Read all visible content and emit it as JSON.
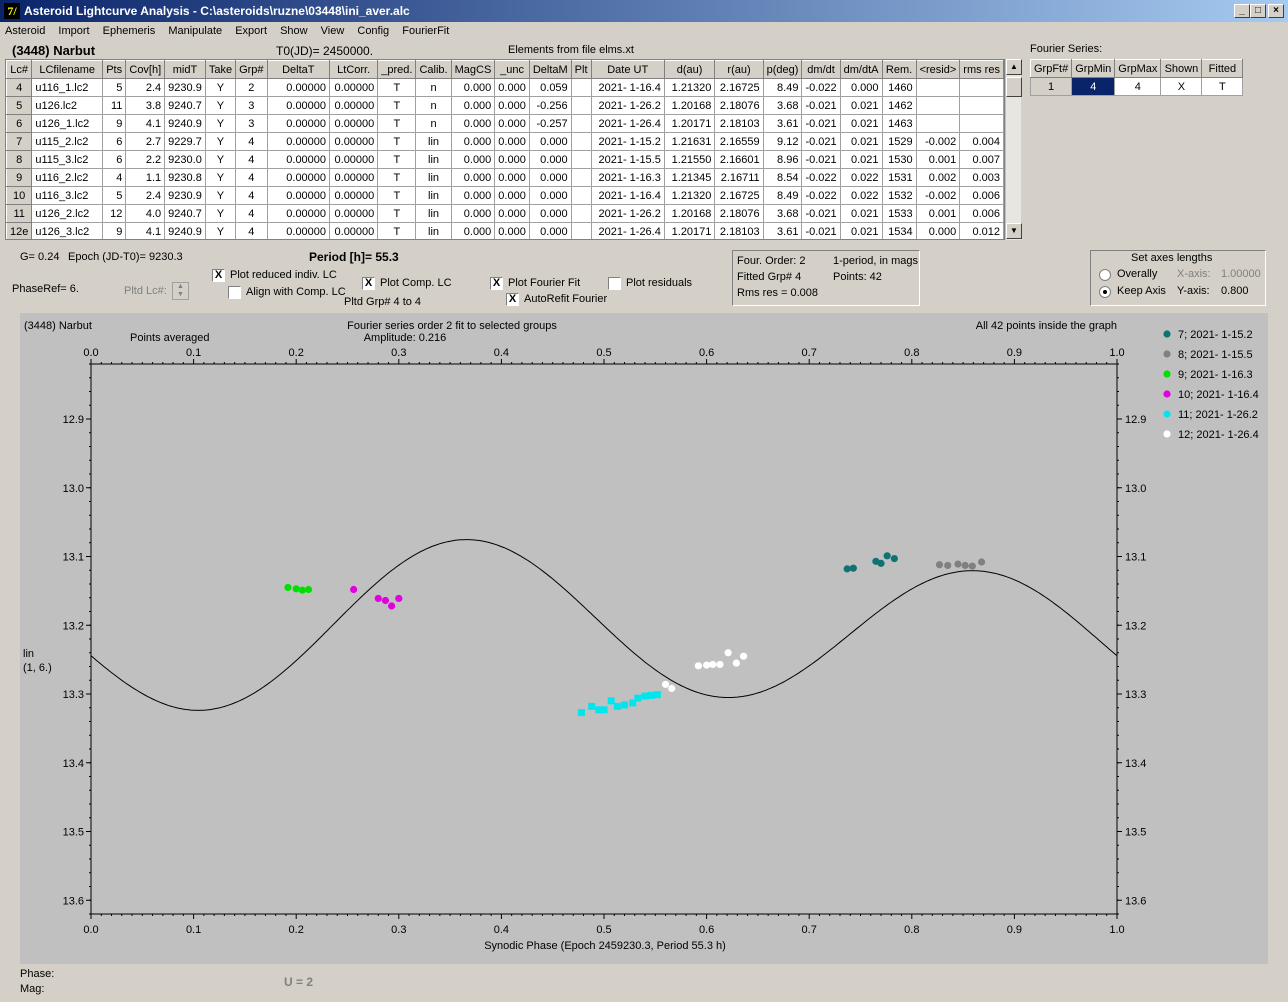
{
  "window": {
    "title": "Asteroid Lightcurve Analysis - C:\\asteroids\\ruzne\\03448\\ini_aver.alc",
    "icon_glyph": "7/"
  },
  "menu": [
    "Asteroid",
    "Import",
    "Ephemeris",
    "Manipulate",
    "Export",
    "Show",
    "View",
    "Config",
    "FourierFit"
  ],
  "header": {
    "asteroid": "(3448) Narbut",
    "t0": "T0(JD)= 2450000.",
    "elements": "Elements from file elms.xt"
  },
  "table": {
    "columns": [
      "Lc#",
      "LCfilename",
      "Pts",
      "Cov[h]",
      "midT",
      "Take",
      "Grp#",
      "DeltaT",
      "LtCorr.",
      "_pred.",
      "Calib.",
      "MagCS",
      "_unc",
      "DeltaM",
      "Plt",
      "Date UT",
      "d(au)",
      "r(au)",
      "p(deg)",
      "dm/dt",
      "dm/dtA",
      "Rem.",
      "<resid>",
      "rms res"
    ],
    "rows": [
      [
        "4",
        "u116_1.lc2",
        "5",
        "2.4",
        "9230.9",
        "Y",
        "2",
        "0.00000",
        "0.00000",
        "T",
        "n",
        "0.000",
        "0.000",
        "0.059",
        "",
        "2021- 1-16.4",
        "1.21320",
        "2.16725",
        "8.49",
        "-0.022",
        "0.000",
        "1460",
        "",
        ""
      ],
      [
        "5",
        "u126.lc2",
        "11",
        "3.8",
        "9240.7",
        "Y",
        "3",
        "0.00000",
        "0.00000",
        "T",
        "n",
        "0.000",
        "0.000",
        "-0.256",
        "",
        "2021- 1-26.2",
        "1.20168",
        "2.18076",
        "3.68",
        "-0.021",
        "0.021",
        "1462",
        "",
        ""
      ],
      [
        "6",
        "u126_1.lc2",
        "9",
        "4.1",
        "9240.9",
        "Y",
        "3",
        "0.00000",
        "0.00000",
        "T",
        "n",
        "0.000",
        "0.000",
        "-0.257",
        "",
        "2021- 1-26.4",
        "1.20171",
        "2.18103",
        "3.61",
        "-0.021",
        "0.021",
        "1463",
        "",
        ""
      ],
      [
        "7",
        "u115_2.lc2",
        "6",
        "2.7",
        "9229.7",
        "Y",
        "4",
        "0.00000",
        "0.00000",
        "T",
        "lin",
        "0.000",
        "0.000",
        "0.000",
        "",
        "2021- 1-15.2",
        "1.21631",
        "2.16559",
        "9.12",
        "-0.021",
        "0.021",
        "1529",
        "-0.002",
        "0.004"
      ],
      [
        "8",
        "u115_3.lc2",
        "6",
        "2.2",
        "9230.0",
        "Y",
        "4",
        "0.00000",
        "0.00000",
        "T",
        "lin",
        "0.000",
        "0.000",
        "0.000",
        "",
        "2021- 1-15.5",
        "1.21550",
        "2.16601",
        "8.96",
        "-0.021",
        "0.021",
        "1530",
        "0.001",
        "0.007"
      ],
      [
        "9",
        "u116_2.lc2",
        "4",
        "1.1",
        "9230.8",
        "Y",
        "4",
        "0.00000",
        "0.00000",
        "T",
        "lin",
        "0.000",
        "0.000",
        "0.000",
        "",
        "2021- 1-16.3",
        "1.21345",
        "2.16711",
        "8.54",
        "-0.022",
        "0.022",
        "1531",
        "0.002",
        "0.003"
      ],
      [
        "10",
        "u116_3.lc2",
        "5",
        "2.4",
        "9230.9",
        "Y",
        "4",
        "0.00000",
        "0.00000",
        "T",
        "lin",
        "0.000",
        "0.000",
        "0.000",
        "",
        "2021- 1-16.4",
        "1.21320",
        "2.16725",
        "8.49",
        "-0.022",
        "0.022",
        "1532",
        "-0.002",
        "0.006"
      ],
      [
        "11",
        "u126_2.lc2",
        "12",
        "4.0",
        "9240.7",
        "Y",
        "4",
        "0.00000",
        "0.00000",
        "T",
        "lin",
        "0.000",
        "0.000",
        "0.000",
        "",
        "2021- 1-26.2",
        "1.20168",
        "2.18076",
        "3.68",
        "-0.021",
        "0.021",
        "1533",
        "0.001",
        "0.006"
      ],
      [
        "12e",
        "u126_3.lc2",
        "9",
        "4.1",
        "9240.9",
        "Y",
        "4",
        "0.00000",
        "0.00000",
        "T",
        "lin",
        "0.000",
        "0.000",
        "0.000",
        "",
        "2021- 1-26.4",
        "1.20171",
        "2.18103",
        "3.61",
        "-0.021",
        "0.021",
        "1534",
        "0.000",
        "0.012"
      ]
    ]
  },
  "fourier": {
    "title": "Fourier Series:",
    "columns": [
      "GrpFt#",
      "GrpMin",
      "GrpMax",
      "Shown",
      "Fitted"
    ],
    "row": [
      "1",
      "4",
      "4",
      "X",
      "T"
    ]
  },
  "info": {
    "g": "G= 0.24",
    "epoch": "Epoch (JD-T0)= 9230.3",
    "period": "Period [h]= 55.3",
    "phaseref": "PhaseRef= 6.",
    "pltd_lc": "Pltd Lc#:",
    "pltd_grp": "Pltd Grp#  4   to   4"
  },
  "checkboxes": {
    "reduced": {
      "label": "Plot reduced indiv. LC",
      "checked": "X"
    },
    "align": {
      "label": "Align with Comp. LC",
      "checked": ""
    },
    "comp": {
      "label": "Plot Comp. LC",
      "checked": "X"
    },
    "fourier": {
      "label": "Plot Fourier Fit",
      "checked": "X"
    },
    "residuals": {
      "label": "Plot residuals",
      "checked": ""
    },
    "autorefit": {
      "label": "AutoRefit Fourier",
      "checked": "X"
    }
  },
  "fitbox": {
    "order": "Four. Order:  2",
    "mode": "1-period, in mags",
    "grp": "Fitted Grp# 4",
    "points": "Points: 42",
    "rms": "Rms res      = 0.008"
  },
  "axes": {
    "title": "Set axes lengths",
    "overally": "Overally",
    "keep": "Keep Axis",
    "xaxis_label": "X-axis:",
    "xaxis_val": "1.00000",
    "yaxis_label": "Y-axis:",
    "yaxis_val": "0.800"
  },
  "status": {
    "phase": "Phase:",
    "mag": "Mag:",
    "u": "U = 2"
  },
  "window_buttons": {
    "minimize": "_",
    "maximize": "□",
    "close": "×"
  },
  "chart_data": {
    "type": "scatter",
    "title": "Fourier series order 2 fit to selected groups",
    "subtitle": "Amplitude: 0.216",
    "top_left": "(3448) Narbut",
    "note_left": "Points averaged",
    "note_right": "All 42 points inside the graph",
    "xlabel": "Synodic Phase (Epoch 2459230.3, Period 55.3 h)",
    "ylabel": "lin",
    "ylabel2": "(1, 6.)",
    "xlim": [
      0.0,
      1.0
    ],
    "ylim": [
      13.62,
      12.82
    ],
    "xticks": [
      "0.0",
      "0.1",
      "0.2",
      "0.3",
      "0.4",
      "0.5",
      "0.6",
      "0.7",
      "0.8",
      "0.9",
      "1.0"
    ],
    "yticks": [
      "12.9",
      "13.0",
      "13.1",
      "13.2",
      "13.3",
      "13.4",
      "13.5",
      "13.6"
    ],
    "fit": {
      "a0": 13.206,
      "c1": 0.0218,
      "s1": -0.0111,
      "c2": 0.0166,
      "s2": 0.1066
    },
    "series": [
      {
        "name": "7; 2021- 1-15.2",
        "color": "#0f7373",
        "marker": "circle",
        "x": [
          0.737,
          0.743,
          0.765,
          0.77,
          0.776,
          0.783
        ],
        "y": [
          13.118,
          13.117,
          13.107,
          13.11,
          13.099,
          13.103
        ]
      },
      {
        "name": "8; 2021- 1-15.5",
        "color": "#808080",
        "marker": "circle",
        "x": [
          0.827,
          0.835,
          0.845,
          0.852,
          0.859,
          0.868
        ],
        "y": [
          13.112,
          13.113,
          13.111,
          13.113,
          13.114,
          13.108
        ]
      },
      {
        "name": "9; 2021- 1-16.3",
        "color": "#00e000",
        "marker": "circle",
        "x": [
          0.192,
          0.2,
          0.206,
          0.212
        ],
        "y": [
          13.145,
          13.147,
          13.149,
          13.148
        ]
      },
      {
        "name": "10; 2021- 1-16.4",
        "color": "#e000e0",
        "marker": "circle",
        "x": [
          0.256,
          0.28,
          0.287,
          0.293,
          0.3
        ],
        "y": [
          13.148,
          13.161,
          13.164,
          13.172,
          13.161
        ]
      },
      {
        "name": "11; 2021- 1-26.2",
        "color": "#00e5ee",
        "marker": "square",
        "x": [
          0.478,
          0.488,
          0.495,
          0.5,
          0.507,
          0.513,
          0.52,
          0.528,
          0.533,
          0.54,
          0.546,
          0.552
        ],
        "y": [
          13.327,
          13.318,
          13.323,
          13.323,
          13.31,
          13.318,
          13.316,
          13.313,
          13.306,
          13.303,
          13.302,
          13.301
        ]
      },
      {
        "name": "12; 2021- 1-26.4",
        "color": "#ffffff",
        "marker": "circle",
        "x": [
          0.56,
          0.566,
          0.592,
          0.6,
          0.606,
          0.613,
          0.621,
          0.629,
          0.636
        ],
        "y": [
          13.286,
          13.292,
          13.259,
          13.258,
          13.257,
          13.257,
          13.24,
          13.255,
          13.245
        ]
      }
    ]
  }
}
